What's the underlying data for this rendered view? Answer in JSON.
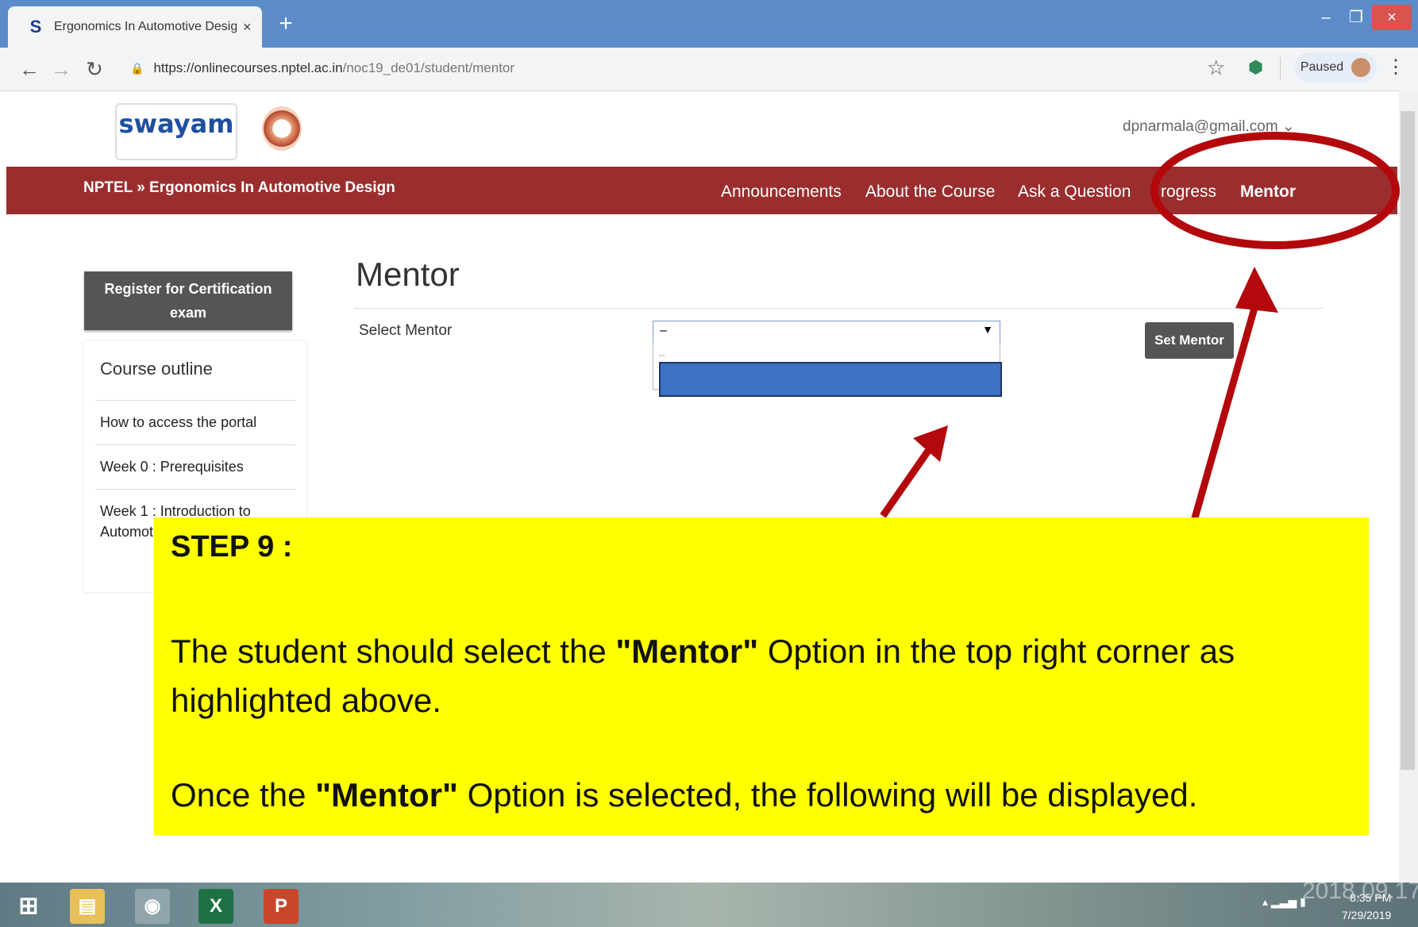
{
  "browser": {
    "tab_title": "Ergonomics In Automotive Desig",
    "tab_favicon": "S",
    "new_tab": "+",
    "url_host": "https://onlinecourses.nptel.ac.in",
    "url_path": "/noc19_de01/student/mentor",
    "profile_label": "Paused",
    "window_controls": {
      "minimize": "–",
      "maximize": "❐",
      "close": "×"
    }
  },
  "header": {
    "logo_text": "swayam",
    "user_email": "dpnarmala@gmail.com ⌄"
  },
  "navbar": {
    "breadcrumb": "NPTEL  »  Ergonomics In Automotive Design",
    "items": [
      "Announcements",
      "About the Course",
      "Ask a Question",
      "rogress",
      "Mentor"
    ]
  },
  "sidebar": {
    "register_button": "Register for Certification exam",
    "outline_title": "Course outline",
    "items": [
      "How to access the portal",
      "Week 0 : Prerequisites",
      "Week 1 : Introduction to",
      "Automot"
    ]
  },
  "main": {
    "title": "Mentor",
    "select_label": "Select Mentor",
    "select_value": "–",
    "dropdown_first_option": "--",
    "set_button": "Set Mentor"
  },
  "callout": {
    "step": "STEP  9 :",
    "line1_pre": "The student should select the ",
    "line1_bold": "\"Mentor\"",
    "line1_post": " Option in the top right corner as highlighted above.",
    "line2_pre": "Once the ",
    "line2_bold": "\"Mentor\"",
    "line2_post": " Option is selected, the following will be displayed."
  },
  "taskbar": {
    "time": "8:35 PM",
    "date": "7/29/2019",
    "watermark": "2018.09.17"
  },
  "colors": {
    "navbar": "#9a2e2e",
    "callout": "#ffff00",
    "annotation": "#b3080c",
    "tabstrip": "#5b8cc9"
  }
}
